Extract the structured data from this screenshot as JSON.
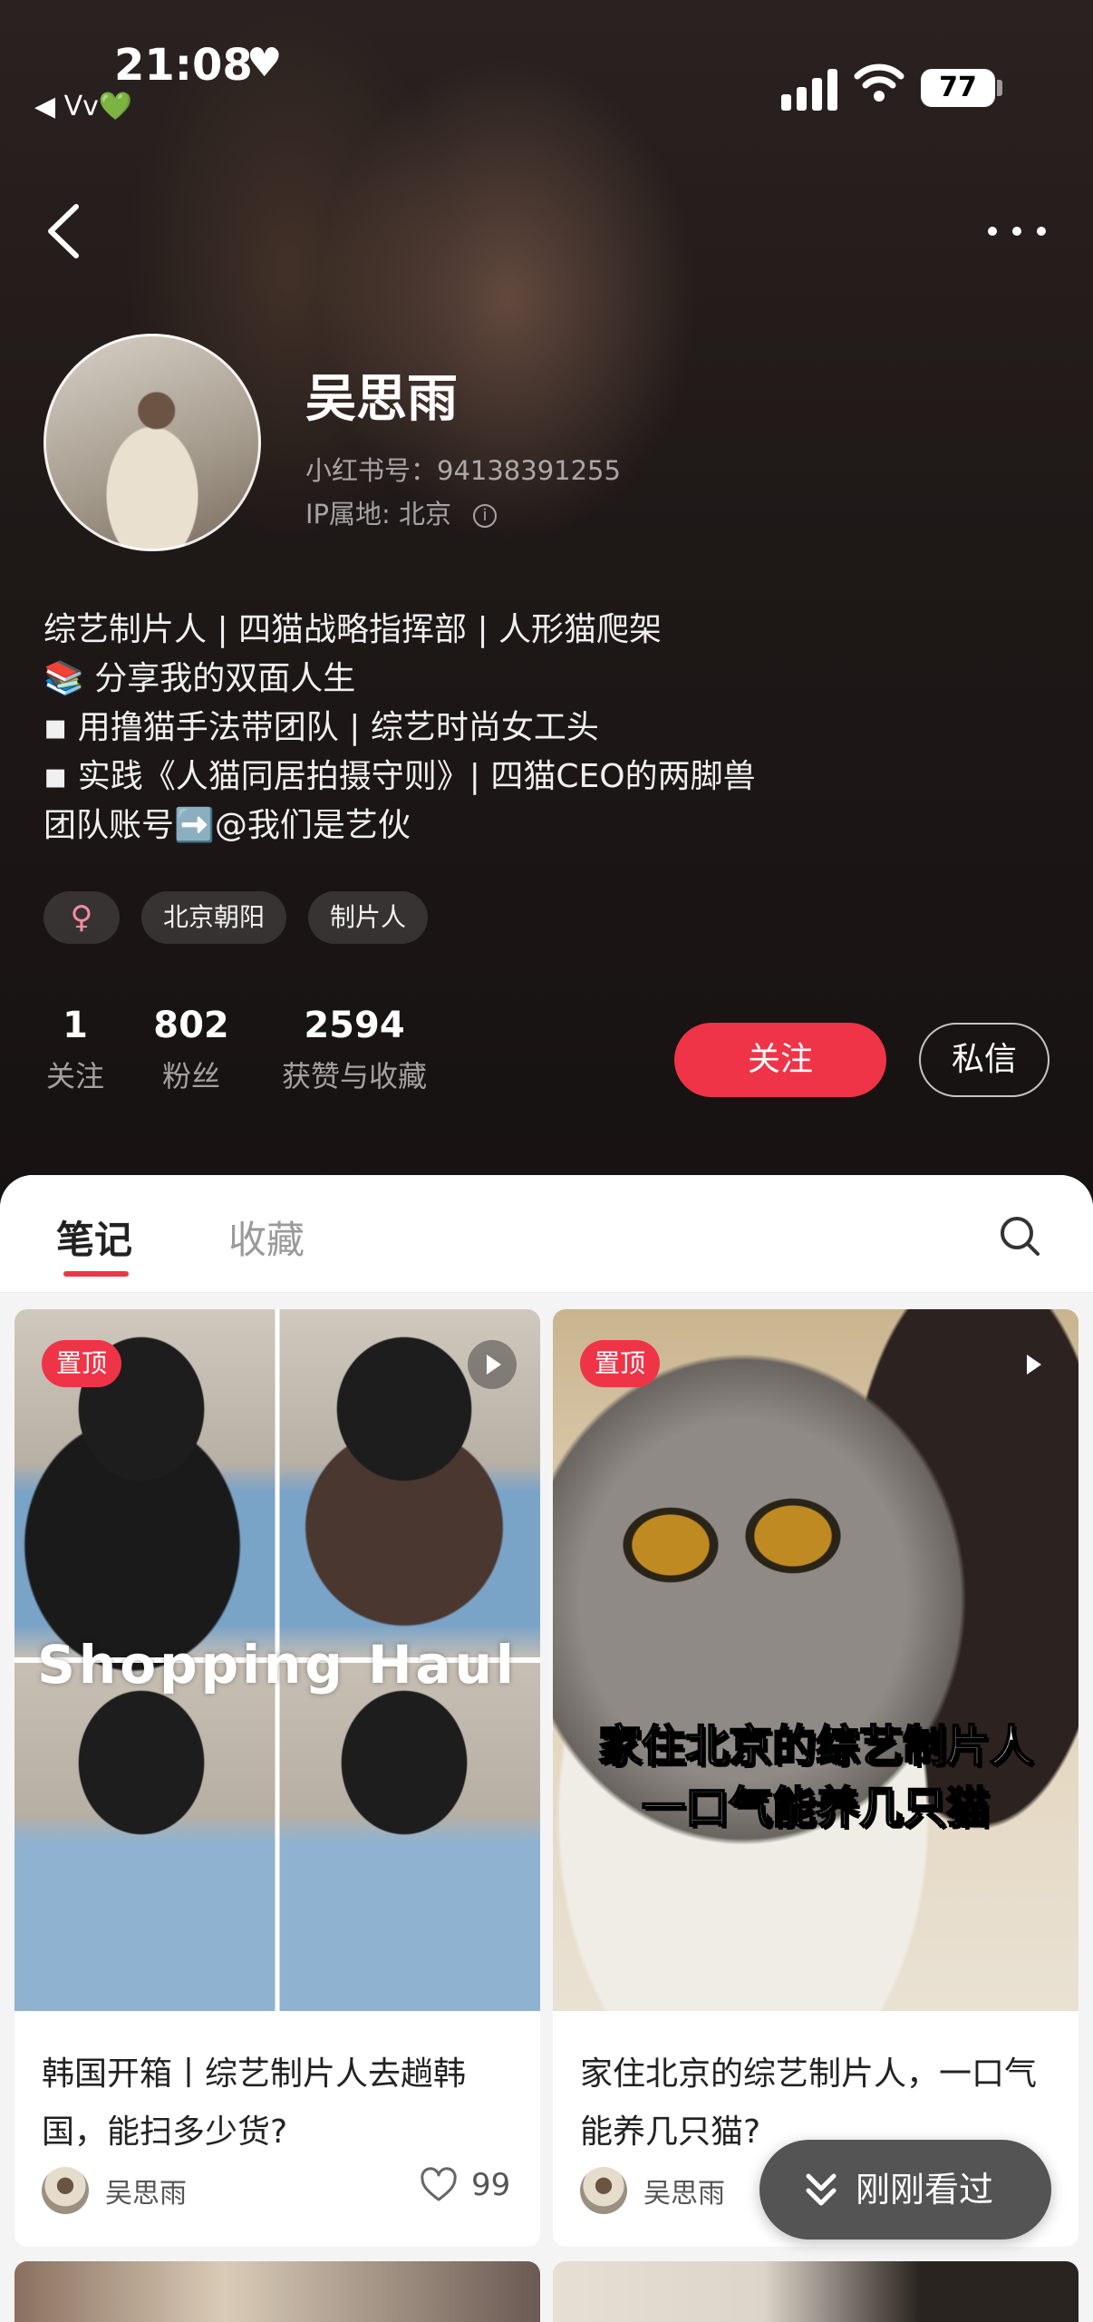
{
  "status_bar": {
    "time": "21:08",
    "carrier": "◀ Vv💚",
    "battery": "77"
  },
  "profile": {
    "name": "吴思雨",
    "red_id": "小红书号：94138391255",
    "ip": "IP属地: 北京",
    "bio": [
      "综艺制片人 | 四猫战略指挥部 | 人形猫爬架",
      "📚 分享我的双面人生",
      "◾ 用撸猫手法带团队 | 综艺时尚女工头",
      "◾ 实践《人猫同居拍摄守则》| 四猫CEO的两脚兽",
      "团队账号➡️@我们是艺伙"
    ],
    "tags": [
      "♀",
      "北京朝阳",
      "制片人"
    ],
    "stats": [
      {
        "value": "1",
        "label": "关注"
      },
      {
        "value": "802",
        "label": "粉丝"
      },
      {
        "value": "2594",
        "label": "获赞与收藏"
      }
    ],
    "follow_label": "关注",
    "message_label": "私信"
  },
  "tabs": [
    "笔记",
    "收藏"
  ],
  "notes": [
    {
      "pin": "置顶",
      "overlay": "Shopping Haul",
      "title": "韩国开箱丨综艺制片人去趟韩国，能扫多少货?",
      "author": "吴思雨",
      "likes": "99"
    },
    {
      "pin": "置顶",
      "overlay_lines": [
        "家住北京的综艺制片人",
        "一口气能养几只猫"
      ],
      "title": "家住北京的综艺制片人，一口气能养几只猫?",
      "author": "吴思雨"
    }
  ],
  "recent_button": "刚刚看过",
  "colors": {
    "accent": "#ef3448",
    "header_bg": "#1e1817",
    "feed_bg": "#f4f4f4"
  },
  "icons": [
    "back-icon",
    "more-icon",
    "search-icon",
    "play-icon",
    "heart-icon",
    "like-icon",
    "chevron-down-icon",
    "info-icon"
  ]
}
